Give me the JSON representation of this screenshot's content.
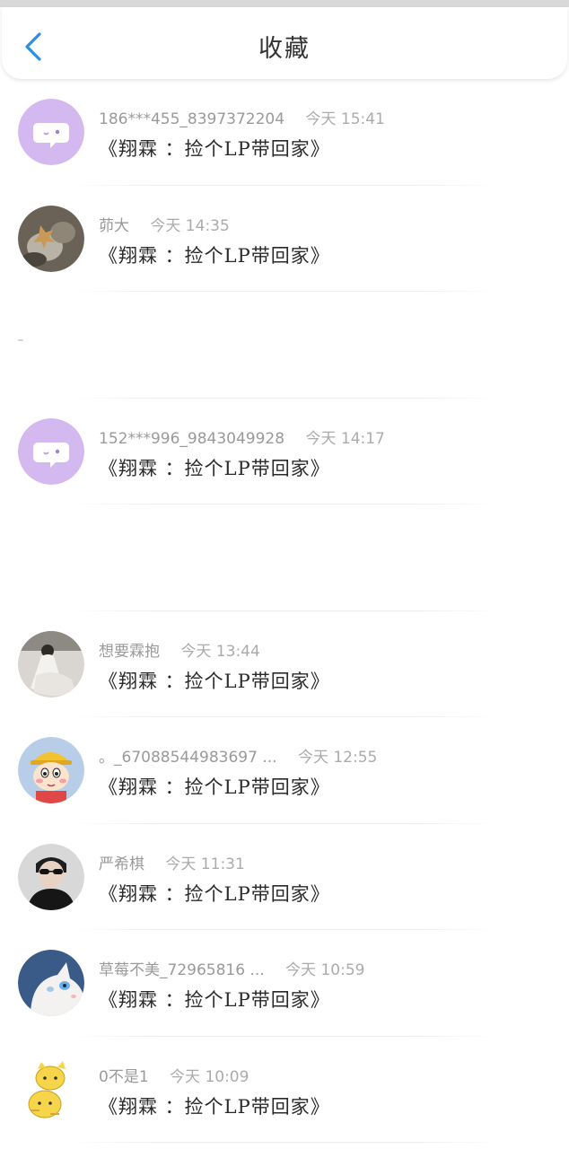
{
  "header": {
    "title": "收藏"
  },
  "items": [
    {
      "name": "186***455_8397372204",
      "time": "今天 15:41",
      "message": "《翔霖 ：捡个LP带回家》",
      "avatar": "chat-bubble-avatar"
    },
    {
      "name": "茆大",
      "time": "今天 14:35",
      "message": "《翔霖 ：捡个LP带回家》",
      "avatar": "photo-avatar"
    },
    {
      "empty": true
    },
    {
      "name": "152***996_9843049928",
      "time": "今天 14:17",
      "message": "《翔霖 ：捡个LP带回家》",
      "avatar": "chat-bubble-avatar"
    },
    {
      "empty": true
    },
    {
      "name": "想要霖抱",
      "time": "今天 13:44",
      "message": "《翔霖 ：捡个LP带回家》",
      "avatar": "photo-avatar"
    },
    {
      "name": "。_67088544983697 ...",
      "time": "今天 12:55",
      "message": "《翔霖 ：捡个LP带回家》",
      "avatar": "cartoon-avatar"
    },
    {
      "name": "严希棋",
      "time": "今天 11:31",
      "message": "《翔霖 ：捡个LP带回家》",
      "avatar": "photo-avatar"
    },
    {
      "name": "草莓不美_72965816 ...",
      "time": "今天 10:59",
      "message": "《翔霖 ：捡个LP带回家》",
      "avatar": "cat-avatar"
    },
    {
      "name": "0不是1",
      "time": "今天 10:09",
      "message": "《翔霖 ：捡个LP带回家》",
      "avatar": "cartoon-avatar"
    }
  ]
}
